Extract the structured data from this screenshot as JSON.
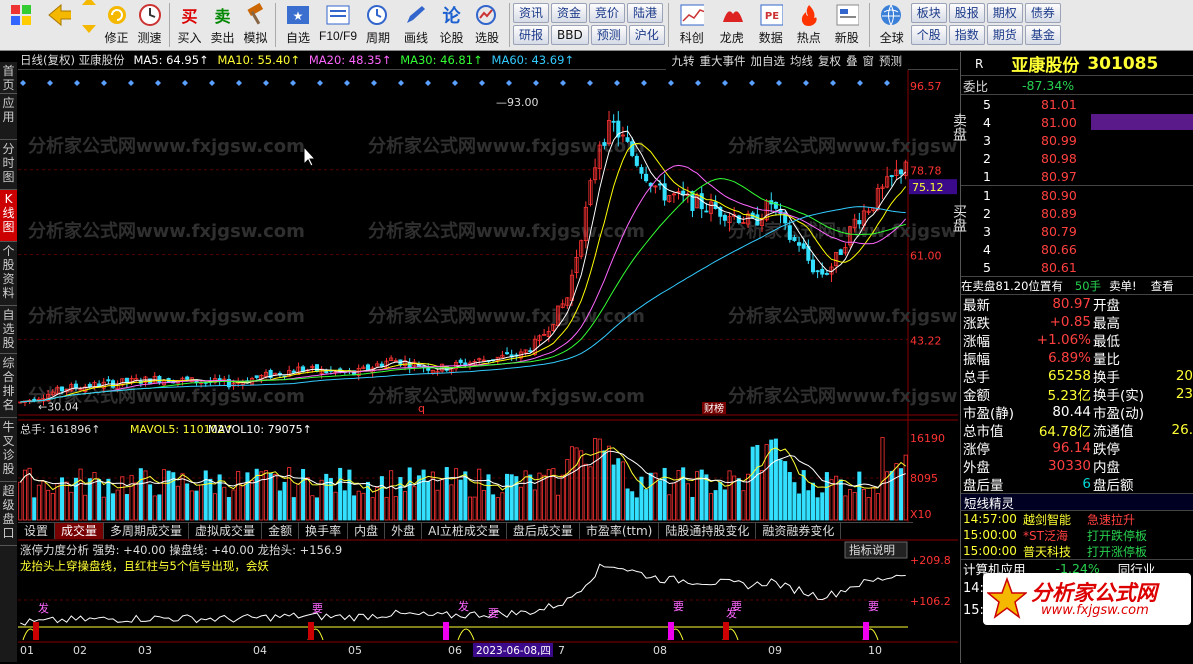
{
  "toolbar": {
    "buttons": [
      "修正",
      "测速",
      "买入",
      "卖出",
      "模拟",
      "自选",
      "F10/F9",
      "周期",
      "画线",
      "论股",
      "选股",
      "科创",
      "龙虎",
      "数据",
      "热点",
      "新股",
      "全球"
    ],
    "pills": [
      "资讯",
      "资金",
      "竞价",
      "陆港",
      "研报",
      "BBD",
      "预测",
      "沪化",
      "板块",
      "股报",
      "期权",
      "债券",
      "个股",
      "指数",
      "期货",
      "基金"
    ]
  },
  "left_tabs": [
    "首页",
    "应用",
    "分时图",
    "K线图",
    "个股资料",
    "自选股",
    "综合排名",
    "牛叉诊股",
    "超级盘口"
  ],
  "chart_header": {
    "line1": "日线(复权) 亚康股份",
    "ma5": "MA5: 64.95↑",
    "ma10": "MA10: 55.40↑",
    "ma20": "MA20: 48.35↑",
    "ma30": "MA30: 46.81↑",
    "ma60": "MA60: 43.69↑",
    "right_items": [
      "九转",
      "重大事件",
      "加自选",
      "均线",
      "复权",
      "叠",
      "窗",
      "预测"
    ]
  },
  "price_axis": [
    "96.57",
    "78.78",
    "75.12",
    "61.00",
    "43.22"
  ],
  "price_markers": [
    "93.00",
    "30.04"
  ],
  "volume_header": {
    "vol": "总手: 161896↑",
    "mavol5": "MAVOL5: 110102↑",
    "mavol10": "MAVOL10: 79075↑",
    "axis": [
      "16190",
      "8095",
      "X10"
    ]
  },
  "sub_tabs": [
    "设置",
    "成交量",
    "多周期成交量",
    "虚拟成交量",
    "金额",
    "换手率",
    "内盘",
    "外盘",
    "AI立桩成交量",
    "盘后成交量",
    "市盈率(ttm)",
    "陆股通持股变化",
    "融资融券变化"
  ],
  "indicator": {
    "title": "涨停力度分析 强势: +40.00 操盘线: +40.00 龙抬头: +156.9",
    "desc": "龙抬头上穿操盘线，且红柱与5个信号出现，会妖",
    "button": "指标说明",
    "axis": [
      "+209.8",
      "+106.2"
    ],
    "labels": [
      "发",
      "要",
      "发",
      "要",
      "要",
      "发",
      "要",
      "要"
    ]
  },
  "xaxis": [
    "01",
    "02",
    "03",
    "04",
    "05",
    "06",
    "2023-06-08,四",
    "7",
    "08",
    "09",
    "10"
  ],
  "event_tags": [
    "q",
    "财",
    "榜"
  ],
  "watermark": "分析家公式网www.fxjgsw.com",
  "stock": {
    "name": "亚康股份",
    "code": "301085",
    "weibi_label": "委比",
    "weibi": "-87.34%",
    "sell_label": "卖盘",
    "buy_label": "买盘",
    "sell": [
      {
        "n": "5",
        "p": "81.01"
      },
      {
        "n": "4",
        "p": "81.00"
      },
      {
        "n": "3",
        "p": "80.99"
      },
      {
        "n": "2",
        "p": "80.98"
      },
      {
        "n": "1",
        "p": "80.97"
      }
    ],
    "buy": [
      {
        "n": "1",
        "p": "80.90"
      },
      {
        "n": "2",
        "p": "80.89"
      },
      {
        "n": "3",
        "p": "80.79"
      },
      {
        "n": "4",
        "p": "80.66"
      },
      {
        "n": "5",
        "p": "80.61"
      }
    ],
    "sell_note": "在卖盘81.20位置有",
    "sell_note_qty": "50手",
    "sell_note_tag": "卖单!",
    "sell_note_link": "查看",
    "stats": [
      {
        "k": "最新",
        "v": "80.97",
        "k2": "开盘",
        "v2": ""
      },
      {
        "k": "涨跌",
        "v": "+0.85",
        "k2": "最高",
        "v2": ""
      },
      {
        "k": "涨幅",
        "v": "+1.06%",
        "k2": "最低",
        "v2": ""
      },
      {
        "k": "振幅",
        "v": "6.89%",
        "k2": "量比",
        "v2": ""
      },
      {
        "k": "总手",
        "v": "65258",
        "k2": "换手",
        "v2": "20"
      },
      {
        "k": "金额",
        "v": "5.23亿",
        "k2": "换手(实)",
        "v2": "23"
      },
      {
        "k": "市盈(静)",
        "v": "80.44",
        "k2": "市盈(动)",
        "v2": ""
      },
      {
        "k": "总市值",
        "v": "64.78亿",
        "k2": "流通值",
        "v2": "26."
      },
      {
        "k": "涨停",
        "v": "96.14",
        "k2": "跌停",
        "v2": ""
      },
      {
        "k": "外盘",
        "v": "30330",
        "k2": "内盘",
        "v2": ""
      },
      {
        "k": "盘后量",
        "v": "6",
        "k2": "盘后额",
        "v2": ""
      }
    ],
    "news_title": "短线精灵",
    "news": [
      {
        "t": "14:57:00",
        "s": "越剑智能",
        "e": "急速拉升"
      },
      {
        "t": "15:00:00",
        "s": "*ST泛海",
        "e": "打开跌停板"
      },
      {
        "t": "15:00:00",
        "s": "普天科技",
        "e": "打开涨停板"
      }
    ],
    "calc_label": "计算机应用",
    "calc_val": "-1.24%",
    "calc_right": "同行业",
    "bottom_times": [
      "14:",
      "15:",
      "15:"
    ],
    "logo": "分析家公式网",
    "logo_url": "www.fxjgsw.com"
  },
  "colors": {
    "up": "#ff3333",
    "down": "#33e0ff",
    "ma5": "#ffffff",
    "ma10": "#ffff00",
    "ma20": "#ff66ff",
    "ma30": "#33ff33",
    "ma60": "#33ccff"
  }
}
